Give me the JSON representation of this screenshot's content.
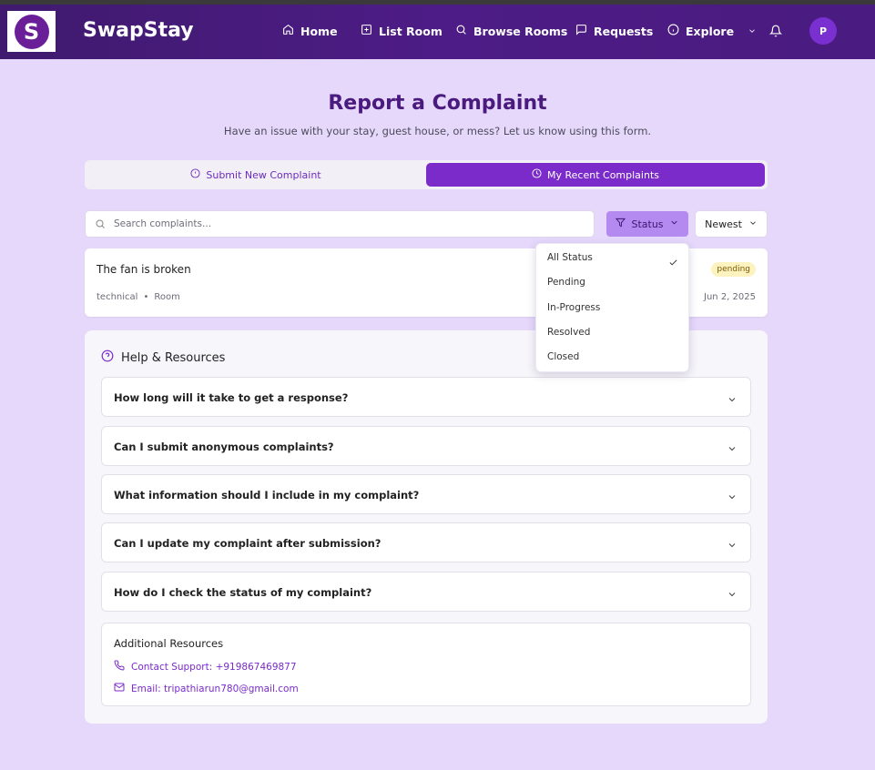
{
  "app": {
    "logo_letter": "S",
    "brand": "SwapStay"
  },
  "nav": {
    "home": "Home",
    "list_room": "List Room",
    "browse_rooms": "Browse Rooms",
    "requests": "Requests",
    "explore": "Explore",
    "avatar_initial": "P"
  },
  "header": {
    "title": "Report a Complaint",
    "subtitle": "Have an issue with your stay, guest house, or mess? Let us know using this form."
  },
  "tabs": {
    "submit": "Submit New Complaint",
    "recent": "My Recent Complaints",
    "active": "recent"
  },
  "filters": {
    "search_placeholder": "Search complaints...",
    "status_label": "Status",
    "sort_label": "Newest",
    "status_options": [
      "All Status",
      "Pending",
      "In-Progress",
      "Resolved",
      "Closed"
    ],
    "selected_status": "All Status"
  },
  "complaints": [
    {
      "title": "The fan is broken",
      "category": "technical",
      "separator": "•",
      "location": "Room",
      "status": "pending",
      "date": "Jun 2, 2025"
    }
  ],
  "help": {
    "title": "Help & Resources",
    "faqs": [
      "How long will it take to get a response?",
      "Can I submit anonymous complaints?",
      "What information should I include in my complaint?",
      "Can I update my complaint after submission?",
      "How do I check the status of my complaint?"
    ],
    "resources_title": "Additional Resources",
    "contact": "Contact Support: +919867469877",
    "email": "Email: tripathiarun780@gmail.com"
  },
  "colors": {
    "accent": "#7a2bc9",
    "navbar": "#4a1b80",
    "page_bg": "#e6d8fb",
    "pending_badge": "#fdf3c0"
  }
}
